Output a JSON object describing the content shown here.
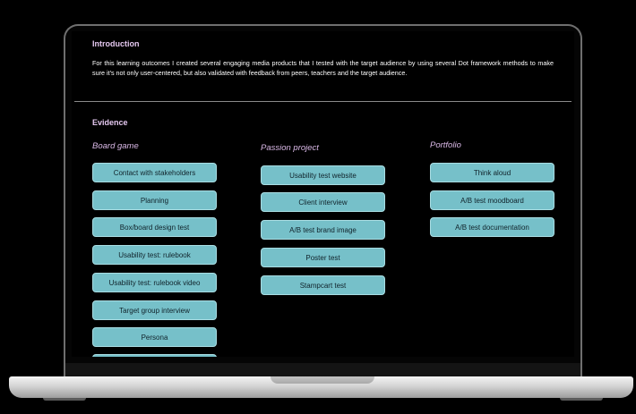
{
  "intro": {
    "title": "Introduction",
    "text": "For this learning outcomes I created several engaging media products that I tested with the target audience by using several Dot framework methods to make sure it's not only user-centered, but also validated with feedback from peers, teachers and the target audience."
  },
  "evidence": {
    "title": "Evidence",
    "columns": [
      {
        "title": "Board game",
        "items": [
          "Contact with stakeholders",
          "Planning",
          "Box/board design test",
          "Usability test: rulebook",
          "Usability test: rulebook video",
          "Target group interview",
          "Persona"
        ]
      },
      {
        "title": "Passion project",
        "items": [
          "Usability test website",
          "Client interview",
          "A/B test brand image",
          "Poster test",
          "Stampcart test"
        ]
      },
      {
        "title": "Portfolio",
        "items": [
          "Think aloud",
          "A/B test moodboard",
          "A/B test documentation"
        ]
      }
    ]
  },
  "colors": {
    "button_bg": "#76c0c9",
    "heading": "#e4c7ef",
    "background": "#000000"
  }
}
